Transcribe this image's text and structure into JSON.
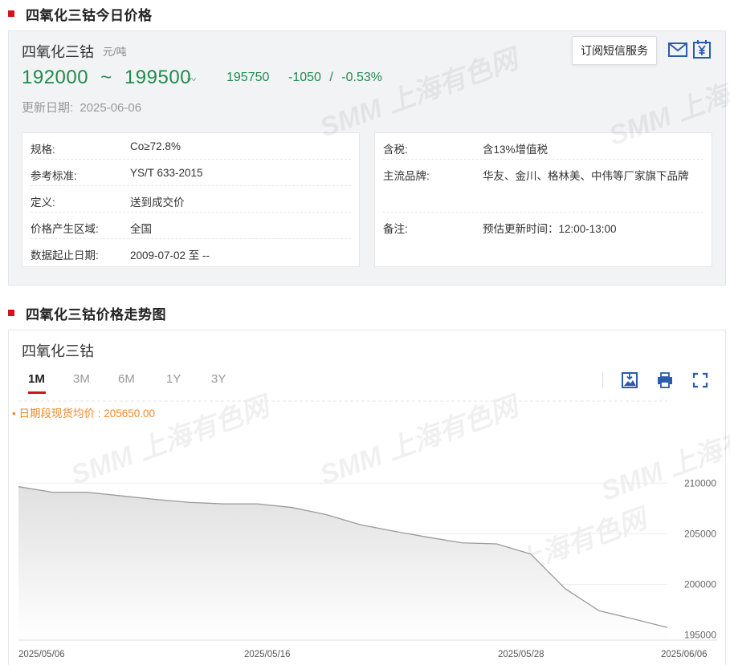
{
  "section1": {
    "title": "四氧化三钴今日价格"
  },
  "product": {
    "name": "四氧化三钴",
    "unit": "元/吨",
    "price_low": "192000",
    "tilde": "~",
    "price_high": "199500",
    "wave_icon": "〰",
    "avg_price": "195750",
    "change": "-1050",
    "slash": "/",
    "change_pct": "-0.53%",
    "update_label": "更新日期:",
    "update_date": "2025-06-06",
    "subscribe_label": "订阅短信服务",
    "price_color": "#1f8b4c"
  },
  "specs_left": [
    {
      "key": "规格:",
      "value": "Co≥72.8%"
    },
    {
      "key": "参考标准:",
      "value": "YS/T 633-2015"
    },
    {
      "key": "定义:",
      "value": "送到成交价"
    },
    {
      "key": "价格产生区域:",
      "value": "全国"
    },
    {
      "key": "数据起止日期:",
      "value": "2009-07-02 至 --"
    }
  ],
  "specs_right": [
    {
      "key": "含税:",
      "value": "含13%增值税"
    },
    {
      "key": "主流品牌:",
      "value": "华友、金川、格林美、中伟等厂家旗下品牌"
    },
    {
      "key": "备注:",
      "value": "预估更新时间：12:00-13:00"
    }
  ],
  "section2": {
    "title": "四氧化三钴价格走势图"
  },
  "chart_panel": {
    "name": "四氧化三钴",
    "ranges": [
      "1M",
      "3M",
      "6M",
      "1Y",
      "3Y"
    ],
    "active_range": "1M",
    "avg_note": "• 日期段现货均价 : 205650.00",
    "tools": [
      "download-image-icon",
      "print-icon",
      "fullscreen-icon"
    ]
  },
  "watermark": "SMM 上海有色网",
  "chart_data": {
    "type": "area",
    "x": [
      "2025/05/06",
      "2025/05/07",
      "2025/05/08",
      "2025/05/09",
      "2025/05/12",
      "2025/05/13",
      "2025/05/14",
      "2025/05/15",
      "2025/05/16",
      "2025/05/19",
      "2025/05/20",
      "2025/05/21",
      "2025/05/22",
      "2025/05/23",
      "2025/05/26",
      "2025/05/27",
      "2025/05/28",
      "2025/05/29",
      "2025/05/30",
      "2025/06/03",
      "2025/06/04",
      "2025/06/05",
      "2025/06/06"
    ],
    "values": [
      209650,
      209100,
      209100,
      208750,
      208400,
      208100,
      207950,
      207950,
      207600,
      206900,
      205900,
      205250,
      204650,
      204100,
      204000,
      203000,
      199600,
      197400,
      196600,
      195750
    ],
    "xticks": [
      "2025/05/06",
      "2025/05/16",
      "2025/05/28",
      "2025/06/06"
    ],
    "yticks": [
      195000,
      200000,
      205000,
      210000
    ],
    "ylim": [
      194500,
      212000
    ],
    "grid": true,
    "line_color": "#9a9a9a",
    "fill_color": "#e0e0e0"
  }
}
